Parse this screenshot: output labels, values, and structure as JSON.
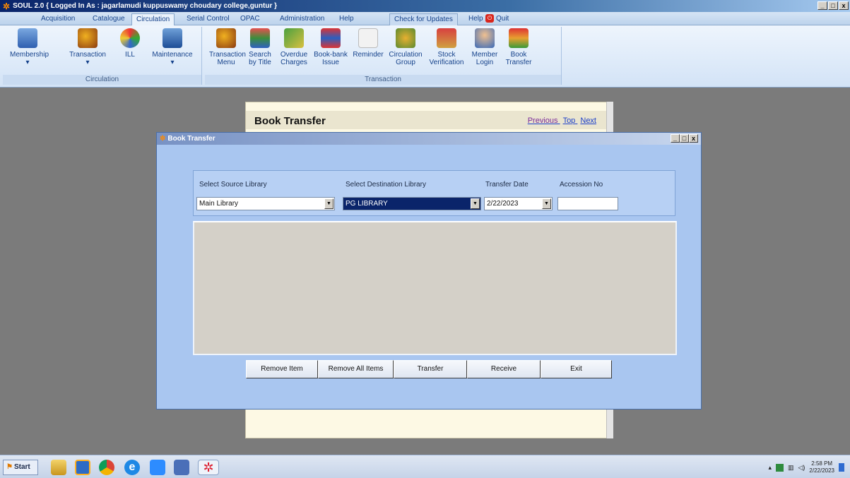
{
  "window": {
    "title": "SOUL 2.0 { Logged In As : jagarlamudi kuppuswamy choudary college,guntur }",
    "controls": [
      "_",
      "□",
      "x"
    ]
  },
  "menu": {
    "tabs": [
      "Acquisition",
      "Catalogue",
      "Circulation",
      "Serial Control",
      "OPAC",
      "Administration",
      "Help"
    ],
    "active_tab": "Circulation",
    "right_items": {
      "check_updates": "Check for Updates",
      "help": "Help",
      "quit": "Quit"
    }
  },
  "ribbon": {
    "circulation_group": {
      "title": "Circulation",
      "buttons": [
        "Membership",
        "Transaction",
        "ILL",
        "Maintenance"
      ]
    },
    "transaction_group": {
      "title": "Transaction",
      "buttons": [
        {
          "line1": "Transaction",
          "line2": "Menu"
        },
        {
          "line1": "Search",
          "line2": "by Title"
        },
        {
          "line1": "Overdue",
          "line2": "Charges"
        },
        {
          "line1": "Book-bank",
          "line2": "Issue"
        },
        {
          "line1": "Reminder",
          "line2": ""
        },
        {
          "line1": "Circulation",
          "line2": "Group"
        },
        {
          "line1": "Stock",
          "line2": "Verification"
        },
        {
          "line1": "Member",
          "line2": "Login"
        },
        {
          "line1": "Book",
          "line2": "Transfer"
        }
      ]
    }
  },
  "help_page": {
    "title": "Book Transfer",
    "nav": [
      "Previous",
      "Top",
      "Next"
    ]
  },
  "dialog": {
    "title": "Book Transfer",
    "labels": {
      "source": "Select Source  Library",
      "destination": "Select Destination  Library",
      "date": "Transfer Date",
      "accession": "Accession No"
    },
    "values": {
      "source": "Main Library",
      "destination": "PG LIBRARY",
      "date": "2/22/2023",
      "accession": ""
    },
    "buttons": [
      "Remove Item",
      "Remove All Items",
      "Transfer",
      "Receive",
      "Exit"
    ]
  },
  "taskbar": {
    "start": "Start",
    "clock_time": "2:58 PM",
    "clock_date": "2/22/2023"
  },
  "colors": {
    "desktop": "#7b7b7b",
    "dialog_bg": "#a9c6f0",
    "grid_bg": "#d4d0c8",
    "selection": "#0a246a"
  }
}
